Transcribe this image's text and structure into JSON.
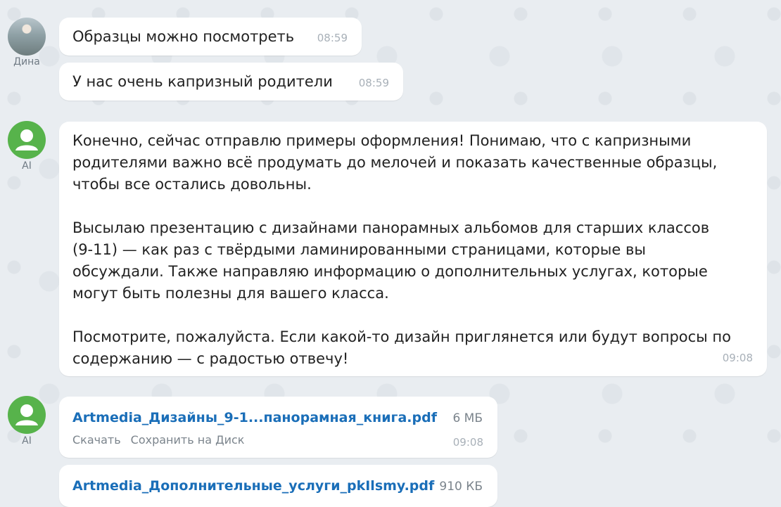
{
  "messages": [
    {
      "author": "Дина",
      "text": "Образцы можно посмотреть",
      "time": "08:59"
    },
    {
      "text": "У нас очень капризный родители",
      "time": "08:59"
    },
    {
      "author": "AI",
      "text": "Конечно, сейчас отправлю примеры оформления! Понимаю, что с капризными\nродителями важно всё продумать до мелочей и показать качественные образцы,\nчтобы все остались довольны.\n\nВысылаю презентацию с дизайнами панорамных альбомов для старших классов\n(9-11) — как раз с твёрдыми ламинированными страницами, которые вы\nобсуждали. Также направляю информацию о дополнительных услугах, которые\nмогут быть полезны для вашего класса.\n\nПосмотрите, пожалуйста. Если какой-то дизайн приглянется или будут вопросы по\nсодержанию — с радостью отвечу!",
      "time": "09:08"
    }
  ],
  "files": [
    {
      "author": "AI",
      "name": "Artmedia_Дизайны_9-1...панорамная_книга.pdf",
      "size": "6 МБ",
      "time": "09:08",
      "download": "Скачать",
      "save": "Сохранить на Диск"
    },
    {
      "name": "Artmedia_Дополнительные_услуги_pkIlsmy.pdf",
      "size": "910 КБ"
    }
  ],
  "colors": {
    "accent_link": "#1a6eb8",
    "ai_avatar": "#57b34b",
    "background": "#e9edf1"
  }
}
